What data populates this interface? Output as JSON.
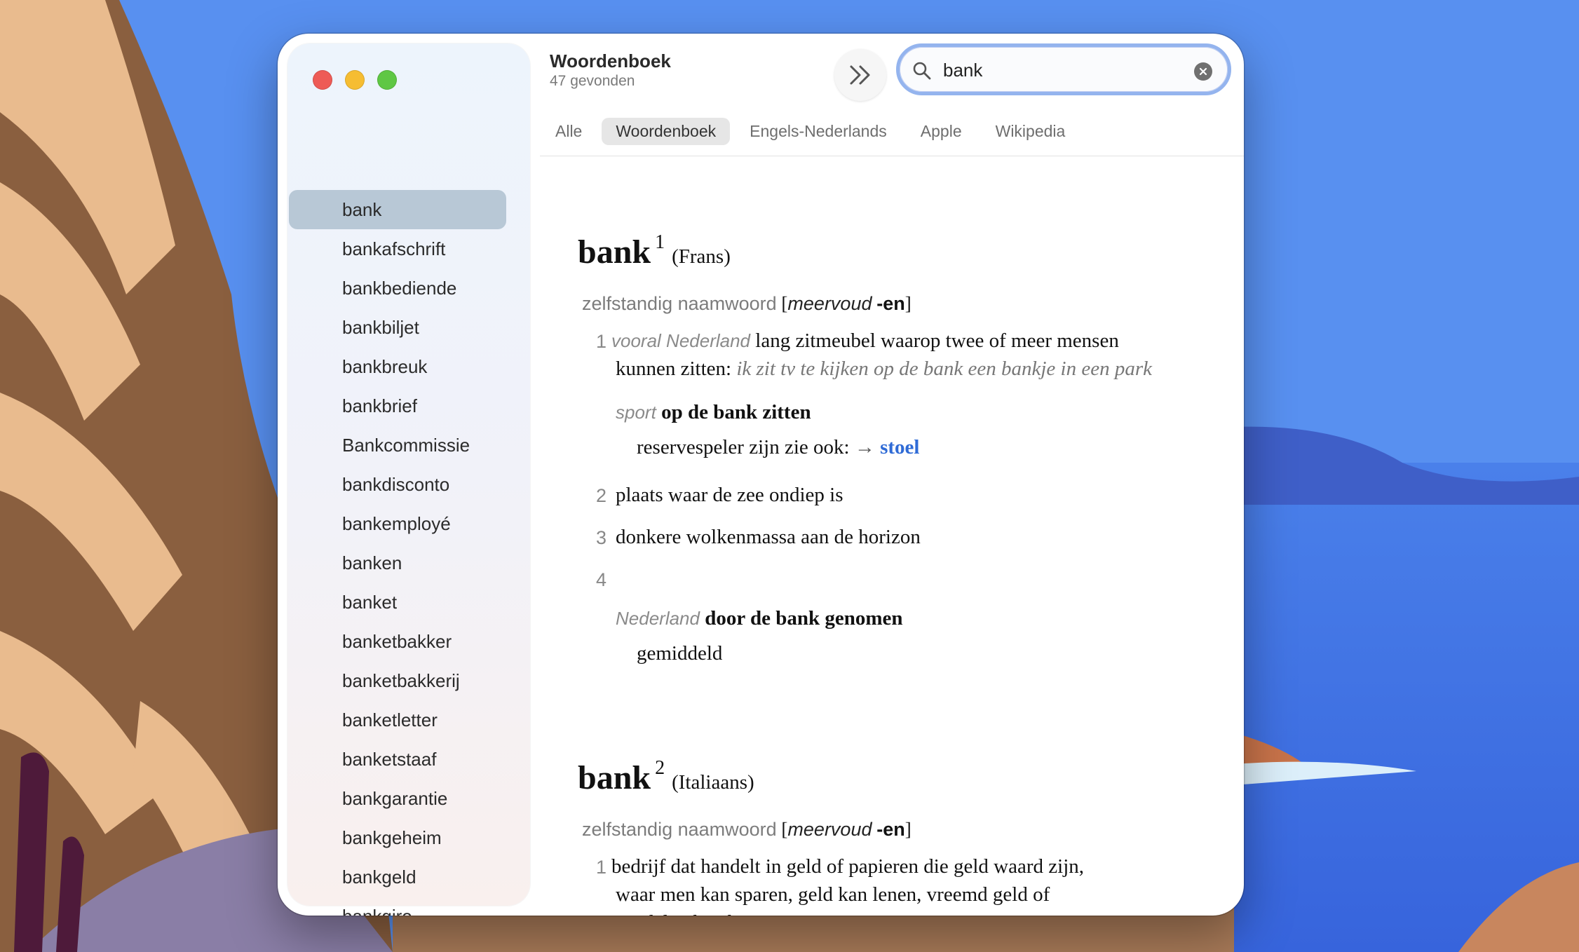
{
  "window": {
    "title": "Woordenboek",
    "subtitle": "47 gevonden"
  },
  "search": {
    "value": "bank",
    "placeholder": ""
  },
  "tabs": [
    {
      "label": "Alle",
      "active": false
    },
    {
      "label": "Woordenboek",
      "active": true
    },
    {
      "label": "Engels-Nederlands",
      "active": false
    },
    {
      "label": "Apple",
      "active": false
    },
    {
      "label": "Wikipedia",
      "active": false
    }
  ],
  "sidebar": {
    "items": [
      "bank",
      "bankafschrift",
      "bankbediende",
      "bankbiljet",
      "bankbreuk",
      "bankbrief",
      "Bankcommissie",
      "bankdisconto",
      "bankemployé",
      "banken",
      "banket",
      "banketbakker",
      "banketbakkerij",
      "banketletter",
      "banketstaaf",
      "bankgarantie",
      "bankgeheim",
      "bankgeld",
      "bankgiro"
    ],
    "selected_index": 0
  },
  "entry1": {
    "word": "bank",
    "sup": "1",
    "origin": "(Frans)",
    "pos": "zelfstandig naamwoord",
    "bracket_open": "[",
    "plural_label": "meervoud",
    "plural": "-en",
    "bracket_close": "]",
    "s1_num": "1",
    "s1_register": "vooral Nederland",
    "s1_def_a": "lang zitmeubel waarop twee of meer mensen",
    "s1_def_b": "kunnen zitten:",
    "s1_example": "ik zit tv te kijken op de bank een bankje in een park",
    "s1_sub_register": "sport",
    "s1_sub_phrase": "op de bank zitten",
    "s1_sub_def": "reservespeler zijn zie ook:",
    "s1_sub_arrow": "→",
    "s1_sub_link": "stoel",
    "s2_num": "2",
    "s2_def": "plaats waar de zee ondiep is",
    "s3_num": "3",
    "s3_def": "donkere wolkenmassa aan de horizon",
    "s4_num": "4",
    "s4_register": "Nederland",
    "s4_phrase": "door de bank genomen",
    "s4_def": "gemiddeld"
  },
  "entry2": {
    "word": "bank",
    "sup": "2",
    "origin": "(Italiaans)",
    "pos": "zelfstandig naamwoord",
    "bracket_open": "[",
    "plural_label": "meervoud",
    "plural": "-en",
    "bracket_close": "]",
    "s1_num": "1",
    "s1_def_a": "bedrijf dat handelt in geld of papieren die geld waard zijn,",
    "s1_def_b": "waar men kan sparen, geld kan lenen, vreemd geld of",
    "s1_def_c": "aandelen kan kopen enz."
  },
  "colors": {
    "accent": "#2f6bd6",
    "sidebar_selected": "#b8c8d6",
    "search_ring": "#94b4ee"
  }
}
